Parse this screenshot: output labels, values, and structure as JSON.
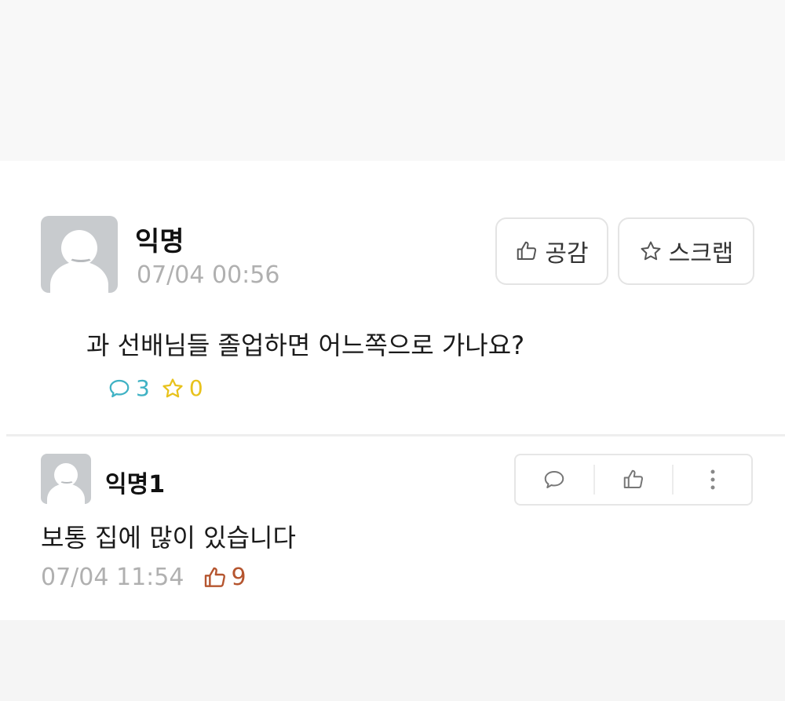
{
  "post": {
    "author": "익명",
    "time": "07/04 00:56",
    "body": "과 선배님들 졸업하면 어느쪽으로 가나요?",
    "like_button_label": "공감",
    "scrap_button_label": "스크랩",
    "comment_count": "3",
    "scrap_count": "0"
  },
  "comment": {
    "author": "익명1",
    "body": "보통 집에 많이 있습니다",
    "time": "07/04 11:54",
    "like_count": "9"
  },
  "colors": {
    "comment_count": "#3fb2c4",
    "scrap_count": "#e8c21c",
    "like_count": "#b5552f",
    "meta_gray": "#b0b0b0"
  },
  "icons": [
    "thumbs-up-icon",
    "star-icon",
    "speech-bubble-icon",
    "more-vertical-icon"
  ]
}
